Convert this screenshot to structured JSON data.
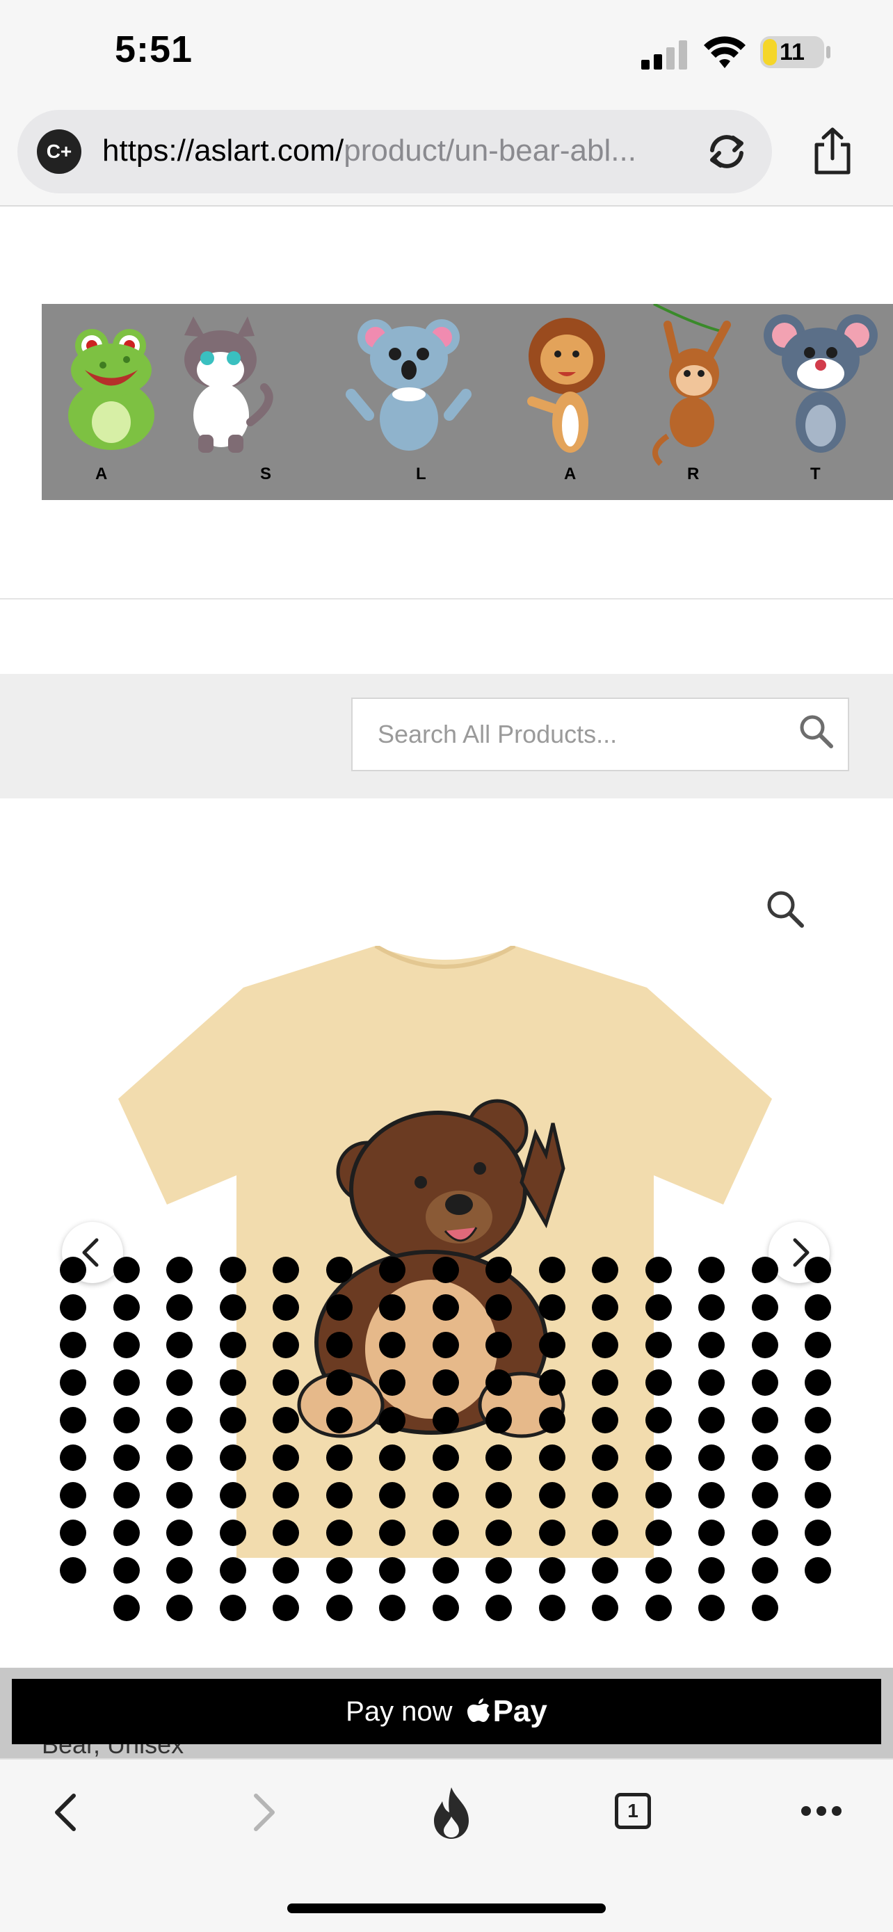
{
  "status_bar": {
    "time": "5:51",
    "battery": "11"
  },
  "browser": {
    "url_domain": "https://aslart.com/",
    "url_path": "product/un-bear-abl...",
    "reader_badge": "C+"
  },
  "banner": {
    "letters": [
      "A",
      "S",
      "L",
      "A",
      "R",
      "T"
    ]
  },
  "search": {
    "placeholder": "Search All Products..."
  },
  "product": {
    "name_peek": "Bear, Unisex"
  },
  "pay": {
    "label": "Pay now",
    "pay_word": "Pay"
  },
  "bottom_nav": {
    "tab_count": "1"
  },
  "colors": {
    "shirt": "#f2dcae",
    "bear": "#6b3b22",
    "banner_bg": "#8a8a8a"
  }
}
